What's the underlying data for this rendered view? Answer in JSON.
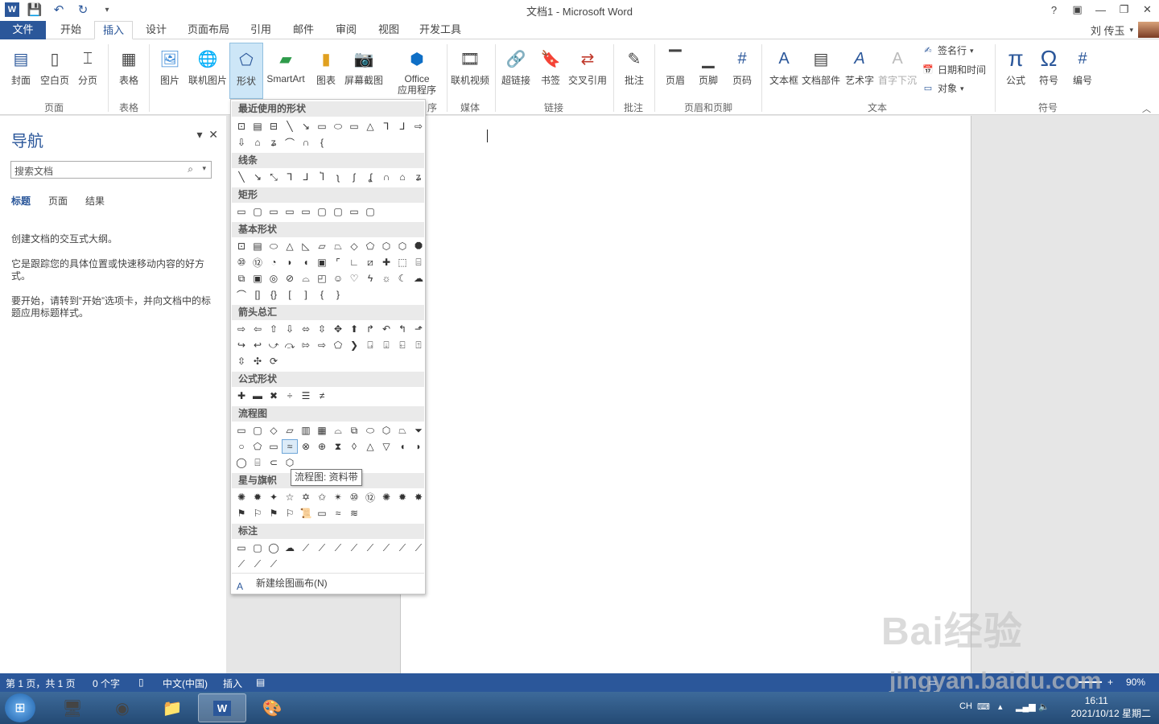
{
  "window": {
    "title": "文档1 - Microsoft Word",
    "help": "?",
    "ribbon_opts": "▣",
    "minimize": "—",
    "restore": "❐",
    "close": "✕"
  },
  "qat": {
    "save_icon": "save-icon",
    "undo_icon": "undo-icon",
    "redo_icon": "redo-icon",
    "customize_icon": "qat-customize-icon"
  },
  "tabs": [
    "文件",
    "开始",
    "插入",
    "设计",
    "页面布局",
    "引用",
    "邮件",
    "审阅",
    "视图",
    "开发工具"
  ],
  "user": {
    "name": "刘 传玉"
  },
  "ribbon": {
    "groups": {
      "page": "页面",
      "table": "表格",
      "apps": "序",
      "media": "媒体",
      "links": "链接",
      "comments": "批注",
      "headerfooter": "页眉和页脚",
      "text": "文本",
      "symbols": "符号"
    },
    "buttons": {
      "cover": "封面",
      "blank": "空白页",
      "pagebreak": "分页",
      "table": "表格",
      "picture": "图片",
      "onlinepic": "联机图片",
      "shapes": "形状",
      "smartart": "SmartArt",
      "chart": "图表",
      "screenshot": "屏幕截图",
      "office1": "Office",
      "office2": "应用程序",
      "video": "联机视频",
      "hyperlink": "超链接",
      "bookmark": "书签",
      "crossref": "交叉引用",
      "comment": "批注",
      "header": "页眉",
      "footer": "页脚",
      "pagenum": "页码",
      "textbox": "文本框",
      "quickparts": "文档部件",
      "wordart": "艺术字",
      "dropcap": "首字下沉",
      "sigline": "签名行",
      "datetime": "日期和时间",
      "object": "对象",
      "equation": "公式",
      "symbol": "符号",
      "number": "编号"
    }
  },
  "nav": {
    "title": "导航",
    "search_placeholder": "搜索文档",
    "tabs": [
      "标题",
      "页面",
      "结果"
    ],
    "text1": "创建文档的交互式大纲。",
    "text2": "它是跟踪您的具体位置或快速移动内容的好方式。",
    "text3": "要开始，请转到“开始”选项卡，并向文档中的标题应用标题样式。"
  },
  "shapes_menu": {
    "sections": [
      "最近使用的形状",
      "线条",
      "矩形",
      "基本形状",
      "箭头总汇",
      "公式形状",
      "流程图",
      "星与旗帜",
      "标注"
    ],
    "tooltip": "流程图: 资料带",
    "new_canvas": "新建绘图画布(N)"
  },
  "status": {
    "page": "第 1 页，共 1 页",
    "words": "0 个字",
    "lang": "中文(中国)",
    "mode": "插入",
    "zoom": "90%"
  },
  "taskbar": {
    "time": "16:11",
    "date": "2021/10/12 星期二",
    "ime": "CH"
  },
  "watermark": {
    "line1": "Bai经验",
    "line2": "jingyan.baidu.com"
  }
}
